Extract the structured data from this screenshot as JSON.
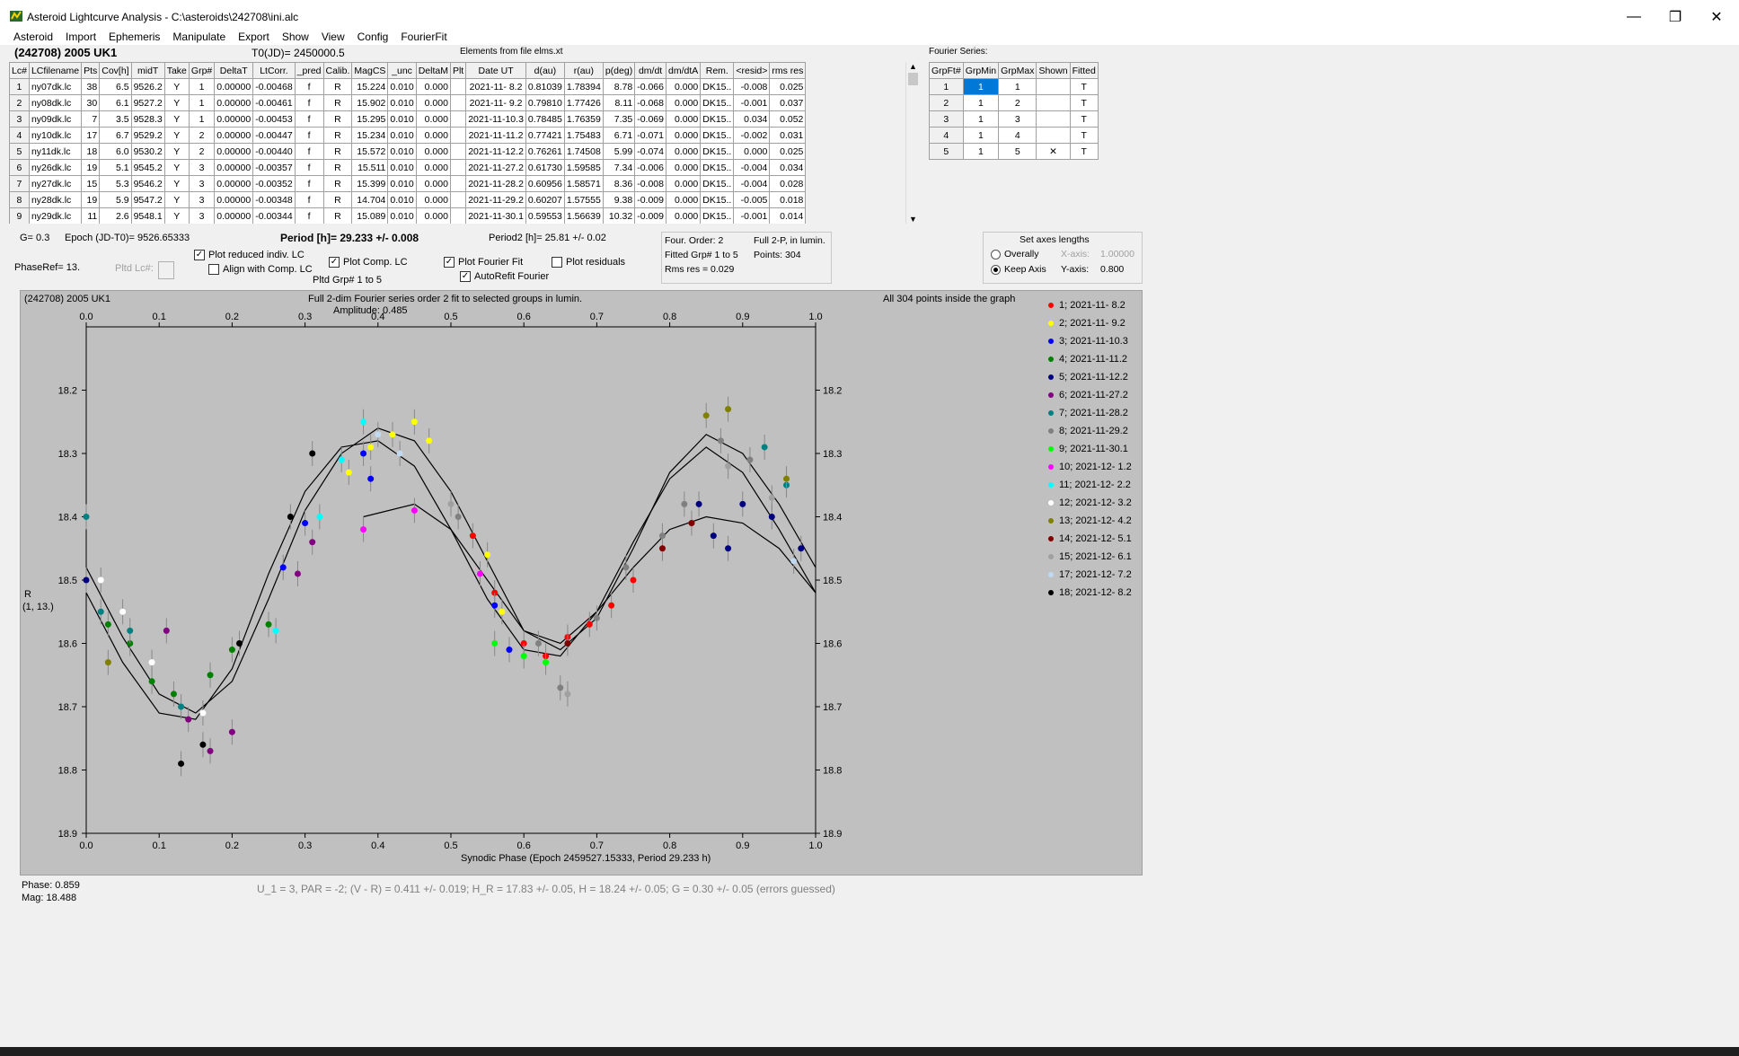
{
  "window": {
    "title": "Asteroid Lightcurve Analysis - C:\\asteroids\\242708\\ini.alc",
    "minimize": "—",
    "restore": "❐",
    "close": "✕"
  },
  "menu": [
    "Asteroid",
    "Import",
    "Ephemeris",
    "Manipulate",
    "Export",
    "Show",
    "View",
    "Config",
    "FourierFit"
  ],
  "header": {
    "object": "(242708) 2005 UK1",
    "t0": "T0(JD)= 2450000.5",
    "elements": "Elements from file elms.xt"
  },
  "lc_table": {
    "columns": [
      "Lc#",
      "LCfilename",
      "Pts",
      "Cov[h]",
      "midT",
      "Take",
      "Grp#",
      "DeltaT",
      "LtCorr.",
      "_pred",
      "Calib.",
      "MagCS",
      "_unc",
      "DeltaM",
      "Plt",
      "Date UT",
      "d(au)",
      "r(au)",
      "p(deg)",
      "dm/dt",
      "dm/dtA",
      "Rem.",
      "<resid>",
      "rms res"
    ],
    "rows": [
      [
        "1",
        "ny07dk.lc",
        "38",
        "6.5",
        "9526.2",
        "Y",
        "1",
        "0.00000",
        "-0.00468",
        "f",
        "R",
        "15.224",
        "0.010",
        "0.000",
        "",
        "2021-11- 8.2",
        "0.81039",
        "1.78394",
        "8.78",
        "-0.066",
        "0.000",
        "DK15..",
        "-0.008",
        "0.025"
      ],
      [
        "2",
        "ny08dk.lc",
        "30",
        "6.1",
        "9527.2",
        "Y",
        "1",
        "0.00000",
        "-0.00461",
        "f",
        "R",
        "15.902",
        "0.010",
        "0.000",
        "",
        "2021-11- 9.2",
        "0.79810",
        "1.77426",
        "8.11",
        "-0.068",
        "0.000",
        "DK15..",
        "-0.001",
        "0.037"
      ],
      [
        "3",
        "ny09dk.lc",
        "7",
        "3.5",
        "9528.3",
        "Y",
        "1",
        "0.00000",
        "-0.00453",
        "f",
        "R",
        "15.295",
        "0.010",
        "0.000",
        "",
        "2021-11-10.3",
        "0.78485",
        "1.76359",
        "7.35",
        "-0.069",
        "0.000",
        "DK15..",
        "0.034",
        "0.052"
      ],
      [
        "4",
        "ny10dk.lc",
        "17",
        "6.7",
        "9529.2",
        "Y",
        "2",
        "0.00000",
        "-0.00447",
        "f",
        "R",
        "15.234",
        "0.010",
        "0.000",
        "",
        "2021-11-11.2",
        "0.77421",
        "1.75483",
        "6.71",
        "-0.071",
        "0.000",
        "DK15..",
        "-0.002",
        "0.031"
      ],
      [
        "5",
        "ny11dk.lc",
        "18",
        "6.0",
        "9530.2",
        "Y",
        "2",
        "0.00000",
        "-0.00440",
        "f",
        "R",
        "15.572",
        "0.010",
        "0.000",
        "",
        "2021-11-12.2",
        "0.76261",
        "1.74508",
        "5.99",
        "-0.074",
        "0.000",
        "DK15..",
        "0.000",
        "0.025"
      ],
      [
        "6",
        "ny26dk.lc",
        "19",
        "5.1",
        "9545.2",
        "Y",
        "3",
        "0.00000",
        "-0.00357",
        "f",
        "R",
        "15.511",
        "0.010",
        "0.000",
        "",
        "2021-11-27.2",
        "0.61730",
        "1.59585",
        "7.34",
        "-0.006",
        "0.000",
        "DK15..",
        "-0.004",
        "0.034"
      ],
      [
        "7",
        "ny27dk.lc",
        "15",
        "5.3",
        "9546.2",
        "Y",
        "3",
        "0.00000",
        "-0.00352",
        "f",
        "R",
        "15.399",
        "0.010",
        "0.000",
        "",
        "2021-11-28.2",
        "0.60956",
        "1.58571",
        "8.36",
        "-0.008",
        "0.000",
        "DK15..",
        "-0.004",
        "0.028"
      ],
      [
        "8",
        "ny28dk.lc",
        "19",
        "5.9",
        "9547.2",
        "Y",
        "3",
        "0.00000",
        "-0.00348",
        "f",
        "R",
        "14.704",
        "0.010",
        "0.000",
        "",
        "2021-11-29.2",
        "0.60207",
        "1.57555",
        "9.38",
        "-0.009",
        "0.000",
        "DK15..",
        "-0.005",
        "0.018"
      ],
      [
        "9",
        "ny29dk.lc",
        "11",
        "2.6",
        "9548.1",
        "Y",
        "3",
        "0.00000",
        "-0.00344",
        "f",
        "R",
        "15.089",
        "0.010",
        "0.000",
        "",
        "2021-11-30.1",
        "0.59553",
        "1.56639",
        "10.32",
        "-0.009",
        "0.000",
        "DK15..",
        "-0.001",
        "0.014"
      ]
    ]
  },
  "fourier_series": {
    "label": "Fourier Series:",
    "columns": [
      "GrpFt#",
      "GrpMin",
      "GrpMax",
      "Shown",
      "Fitted"
    ],
    "rows": [
      [
        "1",
        "1",
        "1",
        "",
        "T"
      ],
      [
        "2",
        "1",
        "2",
        "",
        "T"
      ],
      [
        "3",
        "1",
        "3",
        "",
        "T"
      ],
      [
        "4",
        "1",
        "4",
        "",
        "T"
      ],
      [
        "5",
        "1",
        "5",
        "✕",
        "T"
      ]
    ]
  },
  "params": {
    "g": "G= 0.3",
    "epoch": "Epoch (JD-T0)= 9526.65333",
    "period": "Period [h]= 29.233 +/- 0.008",
    "period2": "Period2 [h]= 25.81 +/- 0.02",
    "phaseref": "PhaseRef= 13.",
    "pltd_lc": "Pltd Lc#:",
    "pltd_grp": "Pltd Grp#  1   to   5",
    "cb_reduced": "Plot reduced indiv. LC",
    "cb_align": "Align with Comp. LC",
    "cb_comp": "Plot Comp. LC",
    "cb_fourier": "Plot Fourier Fit",
    "cb_autorefit": "AutoRefit Fourier",
    "cb_residuals": "Plot residuals"
  },
  "fit_info": {
    "order": "Four. Order:  2",
    "fullp": "Full 2-P, in lumin.",
    "fitted": "Fitted Grp# 1 to 5",
    "points": "Points: 304",
    "rms": "Rms res     = 0.029"
  },
  "axes_box": {
    "title": "Set axes lengths",
    "overally": "Overally",
    "keep": "Keep Axis",
    "xaxis_label": "X-axis:",
    "xaxis_value": "1.00000",
    "yaxis_label": "Y-axis:",
    "yaxis_value": "0.800"
  },
  "plot": {
    "corner_title": "(242708) 2005 UK1",
    "center_title": "Full 2-dim Fourier series order 2 fit to selected groups in lumin.",
    "amplitude": "Amplitude: 0.485",
    "right_title": "All 304 points inside the graph",
    "ylabel": "R",
    "ylabel2": "(1, 13.)",
    "xlabel": "Synodic Phase (Epoch 2459527.15333, Period 29.233 h)"
  },
  "chart_data": {
    "type": "scatter",
    "x_range": [
      0.0,
      1.0
    ],
    "y_range": [
      18.9,
      18.1
    ],
    "y_inverted": true,
    "x_ticks": [
      "0.0",
      "0.1",
      "0.2",
      "0.3",
      "0.4",
      "0.5",
      "0.6",
      "0.7",
      "0.8",
      "0.9",
      "1.0"
    ],
    "y_ticks": [
      "18.2",
      "18.3",
      "18.4",
      "18.5",
      "18.6",
      "18.7",
      "18.8",
      "18.9"
    ],
    "series": [
      {
        "name": "1; 2021-11- 8.2",
        "color": "#ff0000",
        "phase": [
          0.53,
          0.56,
          0.6,
          0.63,
          0.66,
          0.69,
          0.72,
          0.75
        ],
        "mag": [
          18.43,
          18.52,
          18.6,
          18.62,
          18.59,
          18.57,
          18.54,
          18.5
        ]
      },
      {
        "name": "2; 2021-11- 9.2",
        "color": "#ffff00",
        "phase": [
          0.36,
          0.39,
          0.42,
          0.45,
          0.47,
          0.55,
          0.57
        ],
        "mag": [
          18.33,
          18.29,
          18.27,
          18.25,
          18.28,
          18.46,
          18.55
        ]
      },
      {
        "name": "3; 2021-11-10.3",
        "color": "#0000ff",
        "phase": [
          0.27,
          0.3,
          0.38,
          0.39,
          0.56,
          0.58
        ],
        "mag": [
          18.48,
          18.41,
          18.3,
          18.34,
          18.54,
          18.61
        ]
      },
      {
        "name": "4; 2021-11-11.2",
        "color": "#008000",
        "phase": [
          0.03,
          0.06,
          0.09,
          0.12,
          0.17,
          0.2,
          0.25
        ],
        "mag": [
          18.57,
          18.6,
          18.66,
          18.68,
          18.65,
          18.61,
          18.57
        ]
      },
      {
        "name": "5; 2021-11-12.2",
        "color": "#000080",
        "phase": [
          0.0,
          0.84,
          0.86,
          0.88,
          0.9,
          0.94,
          0.98
        ],
        "mag": [
          18.5,
          18.38,
          18.43,
          18.45,
          18.38,
          18.4,
          18.45
        ]
      },
      {
        "name": "6; 2021-11-27.2",
        "color": "#800080",
        "phase": [
          0.11,
          0.14,
          0.17,
          0.2,
          0.29,
          0.31
        ],
        "mag": [
          18.58,
          18.72,
          18.77,
          18.74,
          18.49,
          18.44
        ]
      },
      {
        "name": "7; 2021-11-28.2",
        "color": "#008080",
        "phase": [
          0.0,
          0.02,
          0.06,
          0.13,
          0.93,
          0.96
        ],
        "mag": [
          18.4,
          18.55,
          18.58,
          18.7,
          18.29,
          18.35
        ]
      },
      {
        "name": "8; 2021-11-29.2",
        "color": "#808080",
        "phase": [
          0.51,
          0.62,
          0.65,
          0.7,
          0.74,
          0.79,
          0.82,
          0.87,
          0.91
        ],
        "mag": [
          18.4,
          18.6,
          18.67,
          18.56,
          18.48,
          18.43,
          18.38,
          18.28,
          18.31
        ]
      },
      {
        "name": "9; 2021-11-30.1",
        "color": "#00ff00",
        "phase": [
          0.56,
          0.6,
          0.63
        ],
        "mag": [
          18.6,
          18.62,
          18.63
        ]
      },
      {
        "name": "10; 2021-12- 1.2",
        "color": "#ff00ff",
        "phase": [
          0.38,
          0.45,
          0.54
        ],
        "mag": [
          18.42,
          18.39,
          18.49
        ]
      },
      {
        "name": "11; 2021-12- 2.2",
        "color": "#00ffff",
        "phase": [
          0.26,
          0.32,
          0.35,
          0.38
        ],
        "mag": [
          18.58,
          18.4,
          18.31,
          18.25
        ]
      },
      {
        "name": "12; 2021-12- 3.2",
        "color": "#ffffff",
        "phase": [
          0.02,
          0.05,
          0.09,
          0.16
        ],
        "mag": [
          18.5,
          18.55,
          18.63,
          18.71
        ]
      },
      {
        "name": "13; 2021-12- 4.2",
        "color": "#808000",
        "phase": [
          0.03,
          0.85,
          0.88,
          0.96
        ],
        "mag": [
          18.63,
          18.24,
          18.23,
          18.34
        ]
      },
      {
        "name": "14; 2021-12- 5.1",
        "color": "#800000",
        "phase": [
          0.66,
          0.79,
          0.83
        ],
        "mag": [
          18.6,
          18.45,
          18.41
        ]
      },
      {
        "name": "15; 2021-12- 6.1",
        "color": "#a0a0a0",
        "phase": [
          0.5,
          0.66,
          0.88,
          0.94
        ],
        "mag": [
          18.38,
          18.68,
          18.32,
          18.37
        ]
      },
      {
        "name": "17; 2021-12- 7.2",
        "color": "#c0d8f0",
        "phase": [
          0.4,
          0.43,
          0.97
        ],
        "mag": [
          18.27,
          18.3,
          18.47
        ]
      },
      {
        "name": "18; 2021-12- 8.2",
        "color": "#000000",
        "phase": [
          0.13,
          0.16,
          0.21,
          0.28,
          0.31
        ],
        "mag": [
          18.79,
          18.76,
          18.6,
          18.4,
          18.3
        ]
      }
    ],
    "fits": [
      {
        "phase": [
          0.0,
          0.05,
          0.1,
          0.15,
          0.2,
          0.25,
          0.3,
          0.35,
          0.4,
          0.45,
          0.5,
          0.55,
          0.6,
          0.65,
          0.7,
          0.75,
          0.8,
          0.85,
          0.9,
          0.95,
          1.0
        ],
        "mag": [
          18.48,
          18.59,
          18.68,
          18.71,
          18.66,
          18.53,
          18.39,
          18.3,
          18.26,
          18.28,
          18.36,
          18.47,
          18.58,
          18.61,
          18.56,
          18.45,
          18.33,
          18.27,
          18.3,
          18.38,
          18.48
        ]
      },
      {
        "phase": [
          0.0,
          0.05,
          0.1,
          0.15,
          0.2,
          0.25,
          0.3,
          0.35,
          0.4,
          0.45,
          0.5,
          0.55,
          0.6,
          0.65,
          0.7,
          0.75,
          0.8,
          0.85,
          0.9,
          0.95,
          1.0
        ],
        "mag": [
          18.52,
          18.63,
          18.71,
          18.72,
          18.64,
          18.49,
          18.36,
          18.29,
          18.28,
          18.32,
          18.42,
          18.53,
          18.61,
          18.62,
          18.55,
          18.44,
          18.34,
          18.29,
          18.33,
          18.42,
          18.52
        ]
      },
      {
        "phase": [
          0.38,
          0.45,
          0.5,
          0.55,
          0.6,
          0.65,
          0.7,
          0.75,
          0.8,
          0.85,
          0.9,
          0.95,
          1.0
        ],
        "mag": [
          18.4,
          18.38,
          18.42,
          18.5,
          18.58,
          18.6,
          18.55,
          18.48,
          18.42,
          18.4,
          18.41,
          18.45,
          18.52
        ]
      }
    ]
  },
  "status": {
    "phase": "Phase:   0.859",
    "mag": "Mag:     18.488",
    "bottom": "U_1 = 3, PAR = -2; (V - R) = 0.411 +/- 0.019; H_R = 17.83 +/- 0.05, H = 18.24 +/- 0.05; G = 0.30 +/- 0.05 (errors guessed)"
  }
}
